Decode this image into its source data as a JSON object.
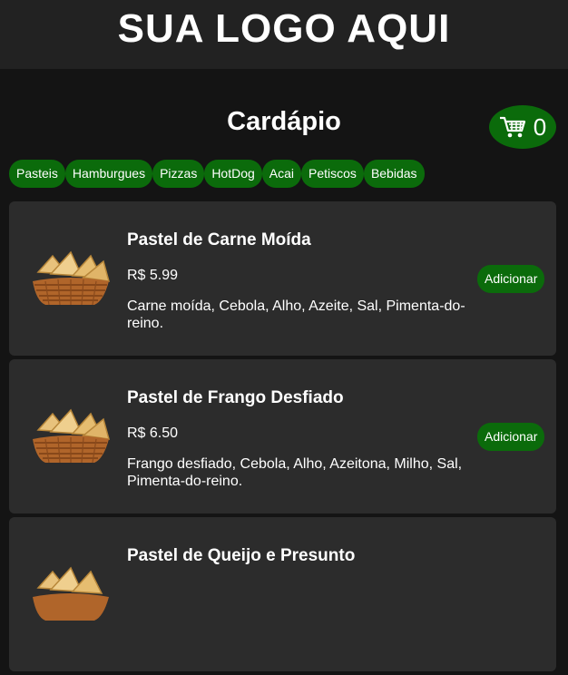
{
  "header": {
    "logo_text": "SUA LOGO AQUI"
  },
  "page": {
    "title": "Cardápio"
  },
  "cart": {
    "icon": "cart-icon",
    "count": "0"
  },
  "categories": [
    "Pasteis",
    "Hamburgues",
    "Pizzas",
    "HotDog",
    "Acai",
    "Petiscos",
    "Bebidas"
  ],
  "products": [
    {
      "name": "Pastel de Carne Moída",
      "price": "R$ 5.99",
      "description": "Carne moída, Cebola, Alho, Azeite, Sal, Pimenta-do-reino.",
      "button": "Adicionar"
    },
    {
      "name": "Pastel de Frango Desfiado",
      "price": "R$ 6.50",
      "description": "Frango desfiado, Cebola, Alho, Azeitona, Milho, Sal, Pimenta-do-reino.",
      "button": "Adicionar"
    },
    {
      "name": "Pastel de Queijo e Presunto",
      "price": "",
      "description": "",
      "button": ""
    }
  ],
  "colors": {
    "accent_green": "#0b6b0b",
    "page_bg": "#141414",
    "header_bg": "#222222",
    "card_bg": "#2c2c2c"
  }
}
